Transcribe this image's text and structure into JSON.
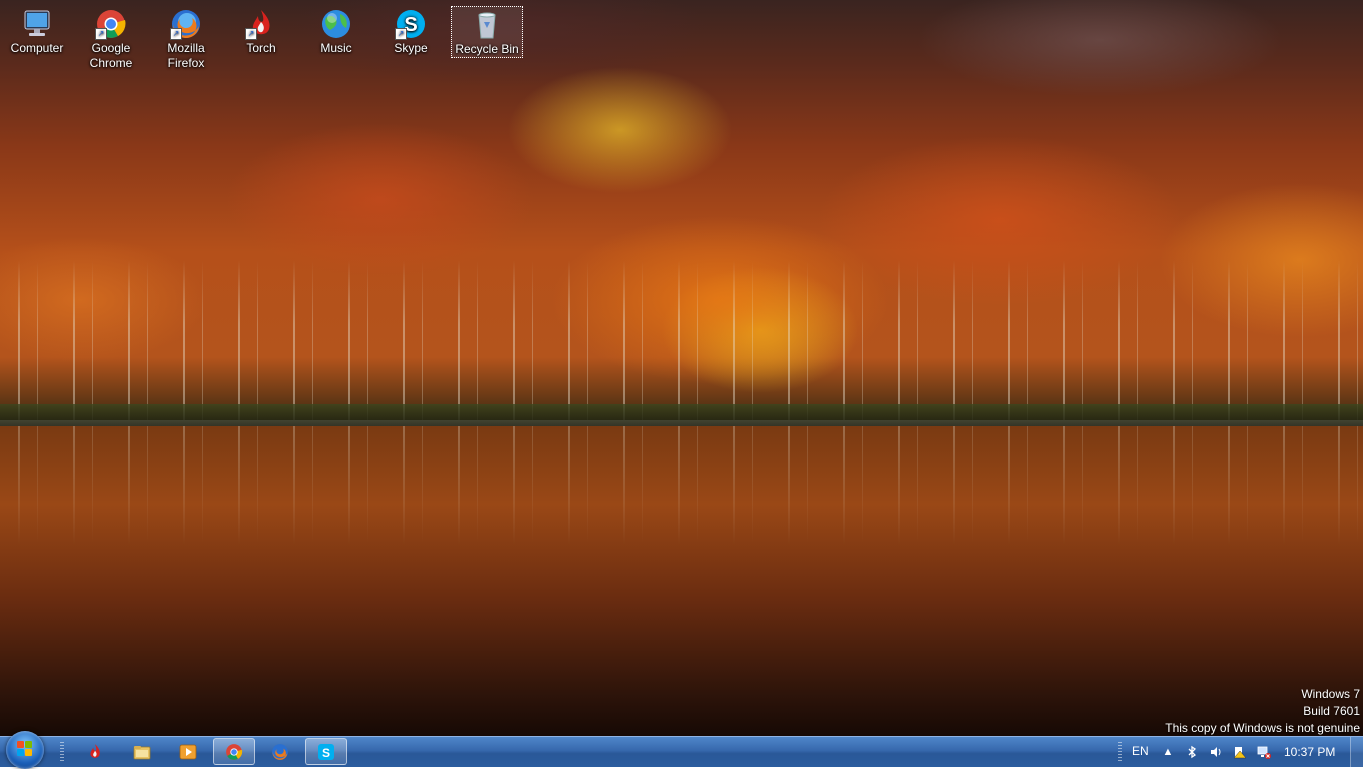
{
  "desktop": {
    "icons": [
      {
        "label": "Computer",
        "icon": "computer-icon"
      },
      {
        "label": "Google\nChrome",
        "icon": "chrome-icon"
      },
      {
        "label": "Mozilla\nFirefox",
        "icon": "firefox-icon"
      },
      {
        "label": "Torch",
        "icon": "torch-icon"
      },
      {
        "label": "Music",
        "icon": "music-icon"
      },
      {
        "label": "Skype",
        "icon": "skype-icon"
      },
      {
        "label": "Recycle Bin",
        "icon": "recycle-bin-icon"
      }
    ]
  },
  "watermark": {
    "line1": "Windows 7",
    "line2": "Build 7601",
    "line3": "This copy of Windows is not genuine"
  },
  "taskbar": {
    "pinned": [
      "torch-icon",
      "file-explorer-icon",
      "media-player-icon",
      "chrome-icon",
      "firefox-icon",
      "skype-icon"
    ],
    "tray": {
      "language": "EN",
      "icons": [
        "show-hidden-icons-chevron",
        "bluetooth-icon",
        "volume-icon",
        "action-center-icon",
        "network-icon"
      ],
      "clock": "10:37 PM"
    }
  },
  "colors": {
    "taskbar": "#3668ad",
    "chrome_red": "#db4437",
    "chrome_green": "#0f9d58",
    "chrome_yellow": "#f4b400",
    "chrome_blue": "#4285f4",
    "skype_blue": "#00aff0"
  }
}
